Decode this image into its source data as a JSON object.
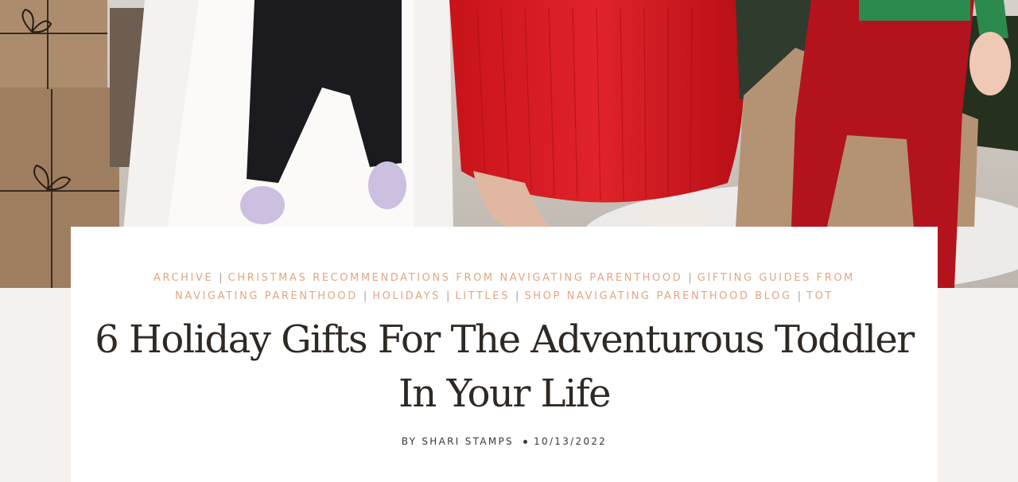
{
  "hero": {
    "image_icon": "holiday-family-photo"
  },
  "post": {
    "categories": [
      "ARCHIVE",
      "CHRISTMAS RECOMMENDATIONS FROM NAVIGATING PARENTHOOD",
      "GIFTING GUIDES FROM NAVIGATING PARENTHOOD",
      "HOLIDAYS",
      "LITTLES",
      "SHOP NAVIGATING PARENTHOOD BLOG",
      "TOT"
    ],
    "separator": "|",
    "title": "6 Holiday Gifts For The Adventurous Toddler In Your Life",
    "byline_prefix": "BY",
    "author": "SHARI STAMPS",
    "date": "10/13/2022"
  },
  "colors": {
    "background": "#f4f1ee",
    "card": "#ffffff",
    "category_link": "#e2a783",
    "title_text": "#2f2924"
  }
}
